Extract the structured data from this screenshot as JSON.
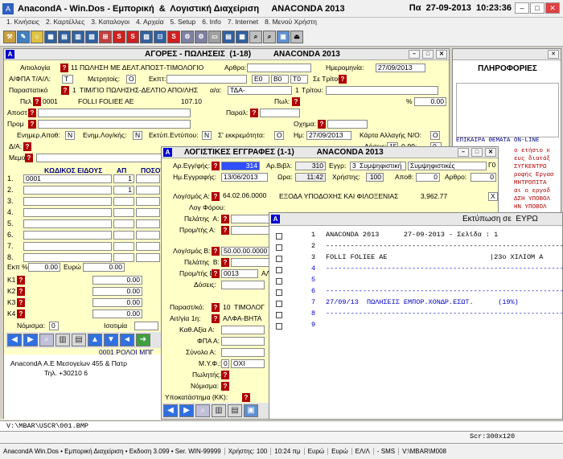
{
  "title": {
    "app": "AnacondA - Win.Dos - Εμπορική  &  Λογιστική Διαχείριση     ANACONDA 2013",
    "date": "Πα  27-09-2013  10:23:36"
  },
  "menu": [
    "1. Κινήσεις",
    "2. Καρτέλλες",
    "3. Καταλογοι",
    "4. Αρχεία",
    "5. Setup",
    "6. Info",
    "7. Internet",
    "8. Μενού Χρήστη"
  ],
  "sales": {
    "title": "ΑΓΟΡΕΣ - ΠΩΛΗΣΕΙΣ  (1-18)          ANACONDA 2013",
    "aitiologia_lbl": "Αιτιολογία",
    "aitiologia": "11",
    "aitiologia_text": "ΠΩΛΗΣΗ ΜΕ ΔΕΛΤ.ΑΠΟΣΤ-ΤΙΜΟΛΟΓΙΟ",
    "arthro_lbl": "Αρθρο:",
    "date_lbl": "Ημερομηνία:",
    "date": "27/09/2013",
    "afpa_lbl": "Α/ΦΠΑ Τ/Α/Λ:",
    "afpa": "Τ",
    "metrhtos_lbl": "Μετρητοίς:",
    "metrhtos": "O",
    "ekpt_lbl": "Εκπτ:",
    "ek_codes": [
      "Ε0",
      "Β0",
      "Τ0"
    ],
    "setritous_lbl": "Σε Τρίτους:",
    "parast_lbl": "Παραστατικό",
    "parast": "1",
    "parast_text": "ΤΙΜ/ΓΙΟ ΠΩΛΗΣΗΣ-ΔΕΛΤΙΟ ΑΠΟ/ΛΗΣ",
    "aa_lbl": "α/α:",
    "aa": "ΤΔΑ-",
    "tritou_lbl": "Τρίτου:",
    "aa_num": "1",
    "pel_lbl": "Πελ",
    "pel_code": "0001",
    "pel_name": "FOLLI FOLIEE AE",
    "pel_bal": "107.10",
    "pol_lbl": "Πωλ:",
    "pct_lbl": "%",
    "pct": "0.00",
    "apost_lbl": "Αποστ",
    "paral_lbl": "Παραλ:",
    "prom_lbl": "Προμ",
    "oxhma_lbl": "Οχημα:",
    "enhm_lbl": "Ενημερ.Αποθ:",
    "enhm": "Ν",
    "enhmlog_lbl": "Ενημ.Λογ/κής:",
    "enhmlog": "Ν",
    "ektyp_lbl": "Εκτύπ.Εντύπου:",
    "ektyp": "Ν",
    "ekkr_lbl": "Σ' εκκρεμότητα:",
    "ekkr": "O",
    "hm_lbl": "Ημ:",
    "hm": "27/09/2013",
    "karta_lbl": "Κάρτα Αλλαγής Ν/Ο:",
    "karta": "O",
    "da_lbl": "Δ/Α:",
    "doses_lbl": "Δόσεις:",
    "doses": "15",
    "doses_range": "0-99:",
    "doses_val": "0",
    "memo_lbl": "Μεμο",
    "col_code": "ΚΩΔΙΚΟΣ ΕΙΔΟΥΣ",
    "col_ap": "ΑΠ",
    "col_pos": "ΠΟΣΟΤ",
    "row1_code": "0001",
    "row1_ap": "1",
    "row2_ap": "1",
    "row_nums": [
      "1.",
      "2.",
      "3.",
      "4.",
      "5.",
      "6.",
      "7.",
      "8."
    ],
    "ekp_lbl": "Εκπ %",
    "ekp": "0.00",
    "eyrw_lbl": "Ευρώ",
    "eyrw": "0.00",
    "k_rows": [
      "K1",
      "K2",
      "K3",
      "K4"
    ],
    "k_val": "0.00",
    "nomisma_lbl": "Νόμισμα:",
    "nomisma": "0",
    "isotimia_lbl": "Ισοτιμία",
    "bottom_text": "0001 ΡΟΛΟΙ ΜΠΓ",
    "company": "AnacondA Α.Ε Μεσογείων 455 & Πατρ",
    "phone": "Τηλ. +30210 6"
  },
  "info": {
    "title": "ΠΛΗΡΟΦΟΡΙΕΣ",
    "news": "ΕΠΙΚΑΙΡΑ ΘΕΜΑΤΑ ON-LINE",
    "lines": [
      "ο ετήσιο κ",
      "ευς διατάξ",
      "ΣΥΓΚΕΝΤΡΩ",
      "ροφής Εργασ",
      "ΜΗΤΡΟΠΙΤΑ",
      "αι ο εργοδ",
      "ΔΣΗ ΥΠΟΒΟΛ",
      "ΗΝ ΥΠΟΒΟΛ"
    ]
  },
  "ledger": {
    "title": "ΛΟΓΙΣΤΙΚΕΣ ΕΓΓΡΑΦΕΣ (1-1)          ANACONDA 2013",
    "areg_lbl": "Αρ.Εγγ/φής:",
    "areg": "314",
    "arvivl_lbl": "Αρ.Βιβλ:",
    "arvivl": "310",
    "eggr_lbl": "Εγγρ:",
    "eggr": "3",
    "eggr_text": "Συμψηφιστική",
    "eggr_text2": "Συμψηφιστικές",
    "f0": "Γ0",
    "hmeggr_lbl": "Ημ.Εγγραφής:",
    "hmeggr": "13/06/2013",
    "wra_lbl": "Ωρα:",
    "wra": "11:42",
    "xrhsths_lbl": "Χρήστης:",
    "xrhsths": "100",
    "apoth_lbl": "Αποθ:",
    "apoth": "0",
    "arthro_lbl": "Αρθρο:",
    "arthro": "0",
    "logA_lbl": "Λογ/σμός Α:",
    "logA": "64.02.06.0000",
    "logA_text": "ΕΞΟΔΑ ΥΠΟΔΟΧΗΣ ΚΑΙ ΦΙΛΟΞΕΝΙΑΣ",
    "logA_amt": "3,962.77",
    "logA_x": "X",
    "logforou_lbl": "Λογ Φόρου:",
    "pelA_lbl": "Πελάτης  Α:",
    "promA_lbl": "Προμ/τής Α:",
    "logB_lbl": "Λογ/σμός Β:",
    "logB": "50.00.00.0000",
    "pelB_lbl": "Πελάτης  Β:",
    "promB_lbl": "Προμ/τής Β:",
    "promB": "0013",
    "promB_tail": "ΑΛ",
    "doses_lbl": "Δόσεις:",
    "parast_lbl": "Παραστ/κό:",
    "parast": "10",
    "parast_text": "ΤΙΜΟΛΟΓ",
    "aityia_lbl": "Αιτ/γία 1η:",
    "aityia": "ΑΛΦΑ-ΒΗΤΑ",
    "kathaxia_lbl": "Καθ.Αξία Α:",
    "fpa_lbl": "ΦΠΑ Α:",
    "synolo_lbl": "Σύνολο Α:",
    "myf_lbl": "Μ.Υ.Φ.:",
    "myf": "0",
    "myf_text": "ΟΧΙ",
    "pwlhths_lbl": "Πωλητής:",
    "nomisma_lbl": "Νόμισμα:",
    "ypokat_lbl": "Υποκατάστημα (ΚΚ):"
  },
  "print": {
    "title": "Εκτύπωση σε  ΕΥΡΩ",
    "lines": [
      {
        "n": "1",
        "t": "ANACONDA 2013      27-09-2013 - Σελίδα : 1"
      },
      {
        "n": "2",
        "t": "----------------------------------------------------------------"
      },
      {
        "n": "3",
        "t": "FOLLI FOLIEE AE                         |23ο ΧΙΛΙΟΜ Α"
      },
      {
        "n": "4",
        "t": "----------------------------------------------------------------"
      },
      {
        "n": "5",
        "t": ""
      },
      {
        "n": "6",
        "t": "----------------------------------------------------------------"
      },
      {
        "n": "7",
        "t": "27/09/13  ΠΩΛΗΣΕΙΣ ΕΜΠΟΡ.ΧΟΝΔΡ.ΕΣΩΤ.      (19%)"
      },
      {
        "n": "8",
        "t": "----------------------------------------------------------------"
      },
      {
        "n": "9",
        "t": ""
      }
    ]
  },
  "pathbar": {
    "path": "V:\\MBAR\\USCR\\001.BMP",
    "scr": "Scr:300x120"
  },
  "status": [
    "AnacondA Win.Dos • Εμπορική Διαχείριση • Εκδοση 3.099 • Ser. WIN-99999",
    "Χρήστης: 100",
    "10:24 πμ",
    "Ευρώ",
    "Ευρώ",
    "ΕΛ/Λ",
    "- SMS",
    "V:\\MBAR\\M008"
  ]
}
